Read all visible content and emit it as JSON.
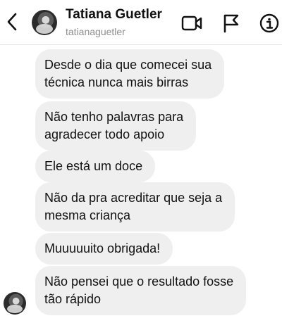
{
  "header": {
    "name": "Tatiana Guetler",
    "username": "tatianaguetler"
  },
  "icons": {
    "back": "chevron-left-icon",
    "video": "video-camera-icon",
    "flag": "flag-icon",
    "info": "info-icon"
  },
  "messages": [
    {
      "lines": [
        "Desde o dia que comecei sua",
        "técnica nunca mais birras"
      ]
    },
    {
      "lines": [
        "Não tenho palavras para",
        "agradecer todo apoio"
      ]
    },
    {
      "lines": [
        "Ele está um doce"
      ]
    },
    {
      "lines": [
        "Não da pra acreditar que seja a",
        "mesma criança"
      ]
    },
    {
      "lines": [
        "Muuuuuito obrigada!"
      ]
    },
    {
      "lines": [
        "Não pensei que o resultado fosse",
        "tão rápido"
      ]
    }
  ],
  "colors": {
    "bubble": "#efefef",
    "text": "#111111",
    "secondary_text": "#8e8e8e"
  }
}
